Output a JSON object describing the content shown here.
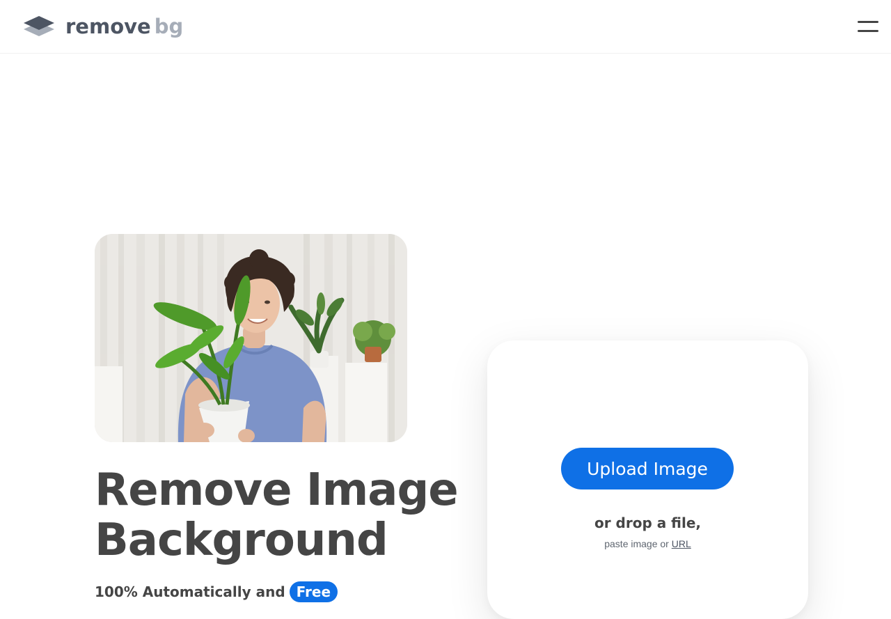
{
  "header": {
    "logo": {
      "icon": "layered-diamond-logo",
      "word_primary": "remove",
      "word_secondary": "bg",
      "colors": {
        "primary": "#4d5563",
        "secondary": "#a6adb8"
      }
    },
    "menu": {
      "icon": "hamburger-menu-icon"
    }
  },
  "hero": {
    "image": {
      "description_icon": "photo-man-holding-plant"
    },
    "headline_line1": "Remove Image",
    "headline_line2": "Background",
    "subline_text": "100% Automatically and",
    "subline_badge": "Free"
  },
  "upload": {
    "button_label": "Upload Image",
    "drop_text": "or drop a file,",
    "paste_prefix": "paste image or",
    "url_link": "URL"
  },
  "colors": {
    "accent": "#0f70e6",
    "text": "#454545",
    "background": "#ffffff"
  }
}
